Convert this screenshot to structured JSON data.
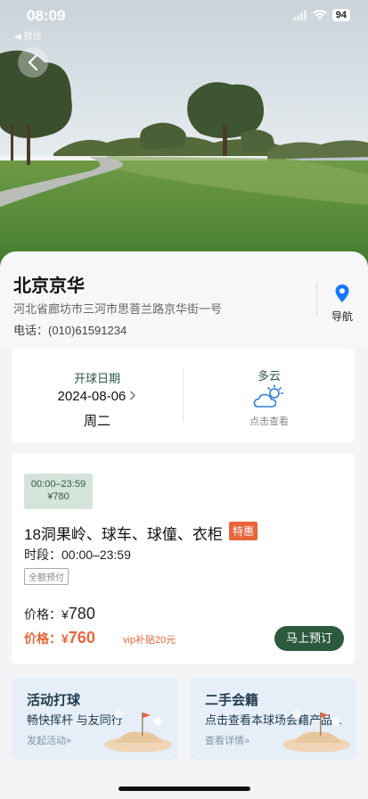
{
  "status_bar": {
    "time": "08:09",
    "carrier": "◀ 微信",
    "battery": "94"
  },
  "club": {
    "name": "北京京华",
    "address": "河北省廊坊市三河市思菩兰路京华街一号",
    "phone": "电话：(010)61591234",
    "nav_label": "导航"
  },
  "booking_date": {
    "label": "开球日期",
    "date": "2024-08-06",
    "weekday": "周二"
  },
  "weather": {
    "label": "多云",
    "link": "点击查看",
    "icon": "partly-cloudy-icon"
  },
  "product": {
    "chip_time": "00:00–23:59",
    "chip_price": "¥780",
    "title": "18洞果岭、球车、球僮、衣柜",
    "badge": "特惠",
    "period": "时段：00:00–23:59",
    "payment_tag": "全额预付",
    "price_label": "价格：",
    "price_currency": "¥",
    "price": "780",
    "vip_label": "价格：",
    "vip_currency": "¥",
    "vip_price": "760",
    "vip_subsidy": "vip补贴20元",
    "book_button": "马上预订"
  },
  "promos": [
    {
      "title": "活动打球",
      "subtitle": "畅快挥杆 与友同行",
      "link": "发起活动»"
    },
    {
      "title": "二手会籍",
      "subtitle": "点击查看本球场会籍产品...",
      "link": "查看详情»"
    }
  ],
  "colors": {
    "accent": "#2c5a3f",
    "promo": "#e8653b"
  }
}
